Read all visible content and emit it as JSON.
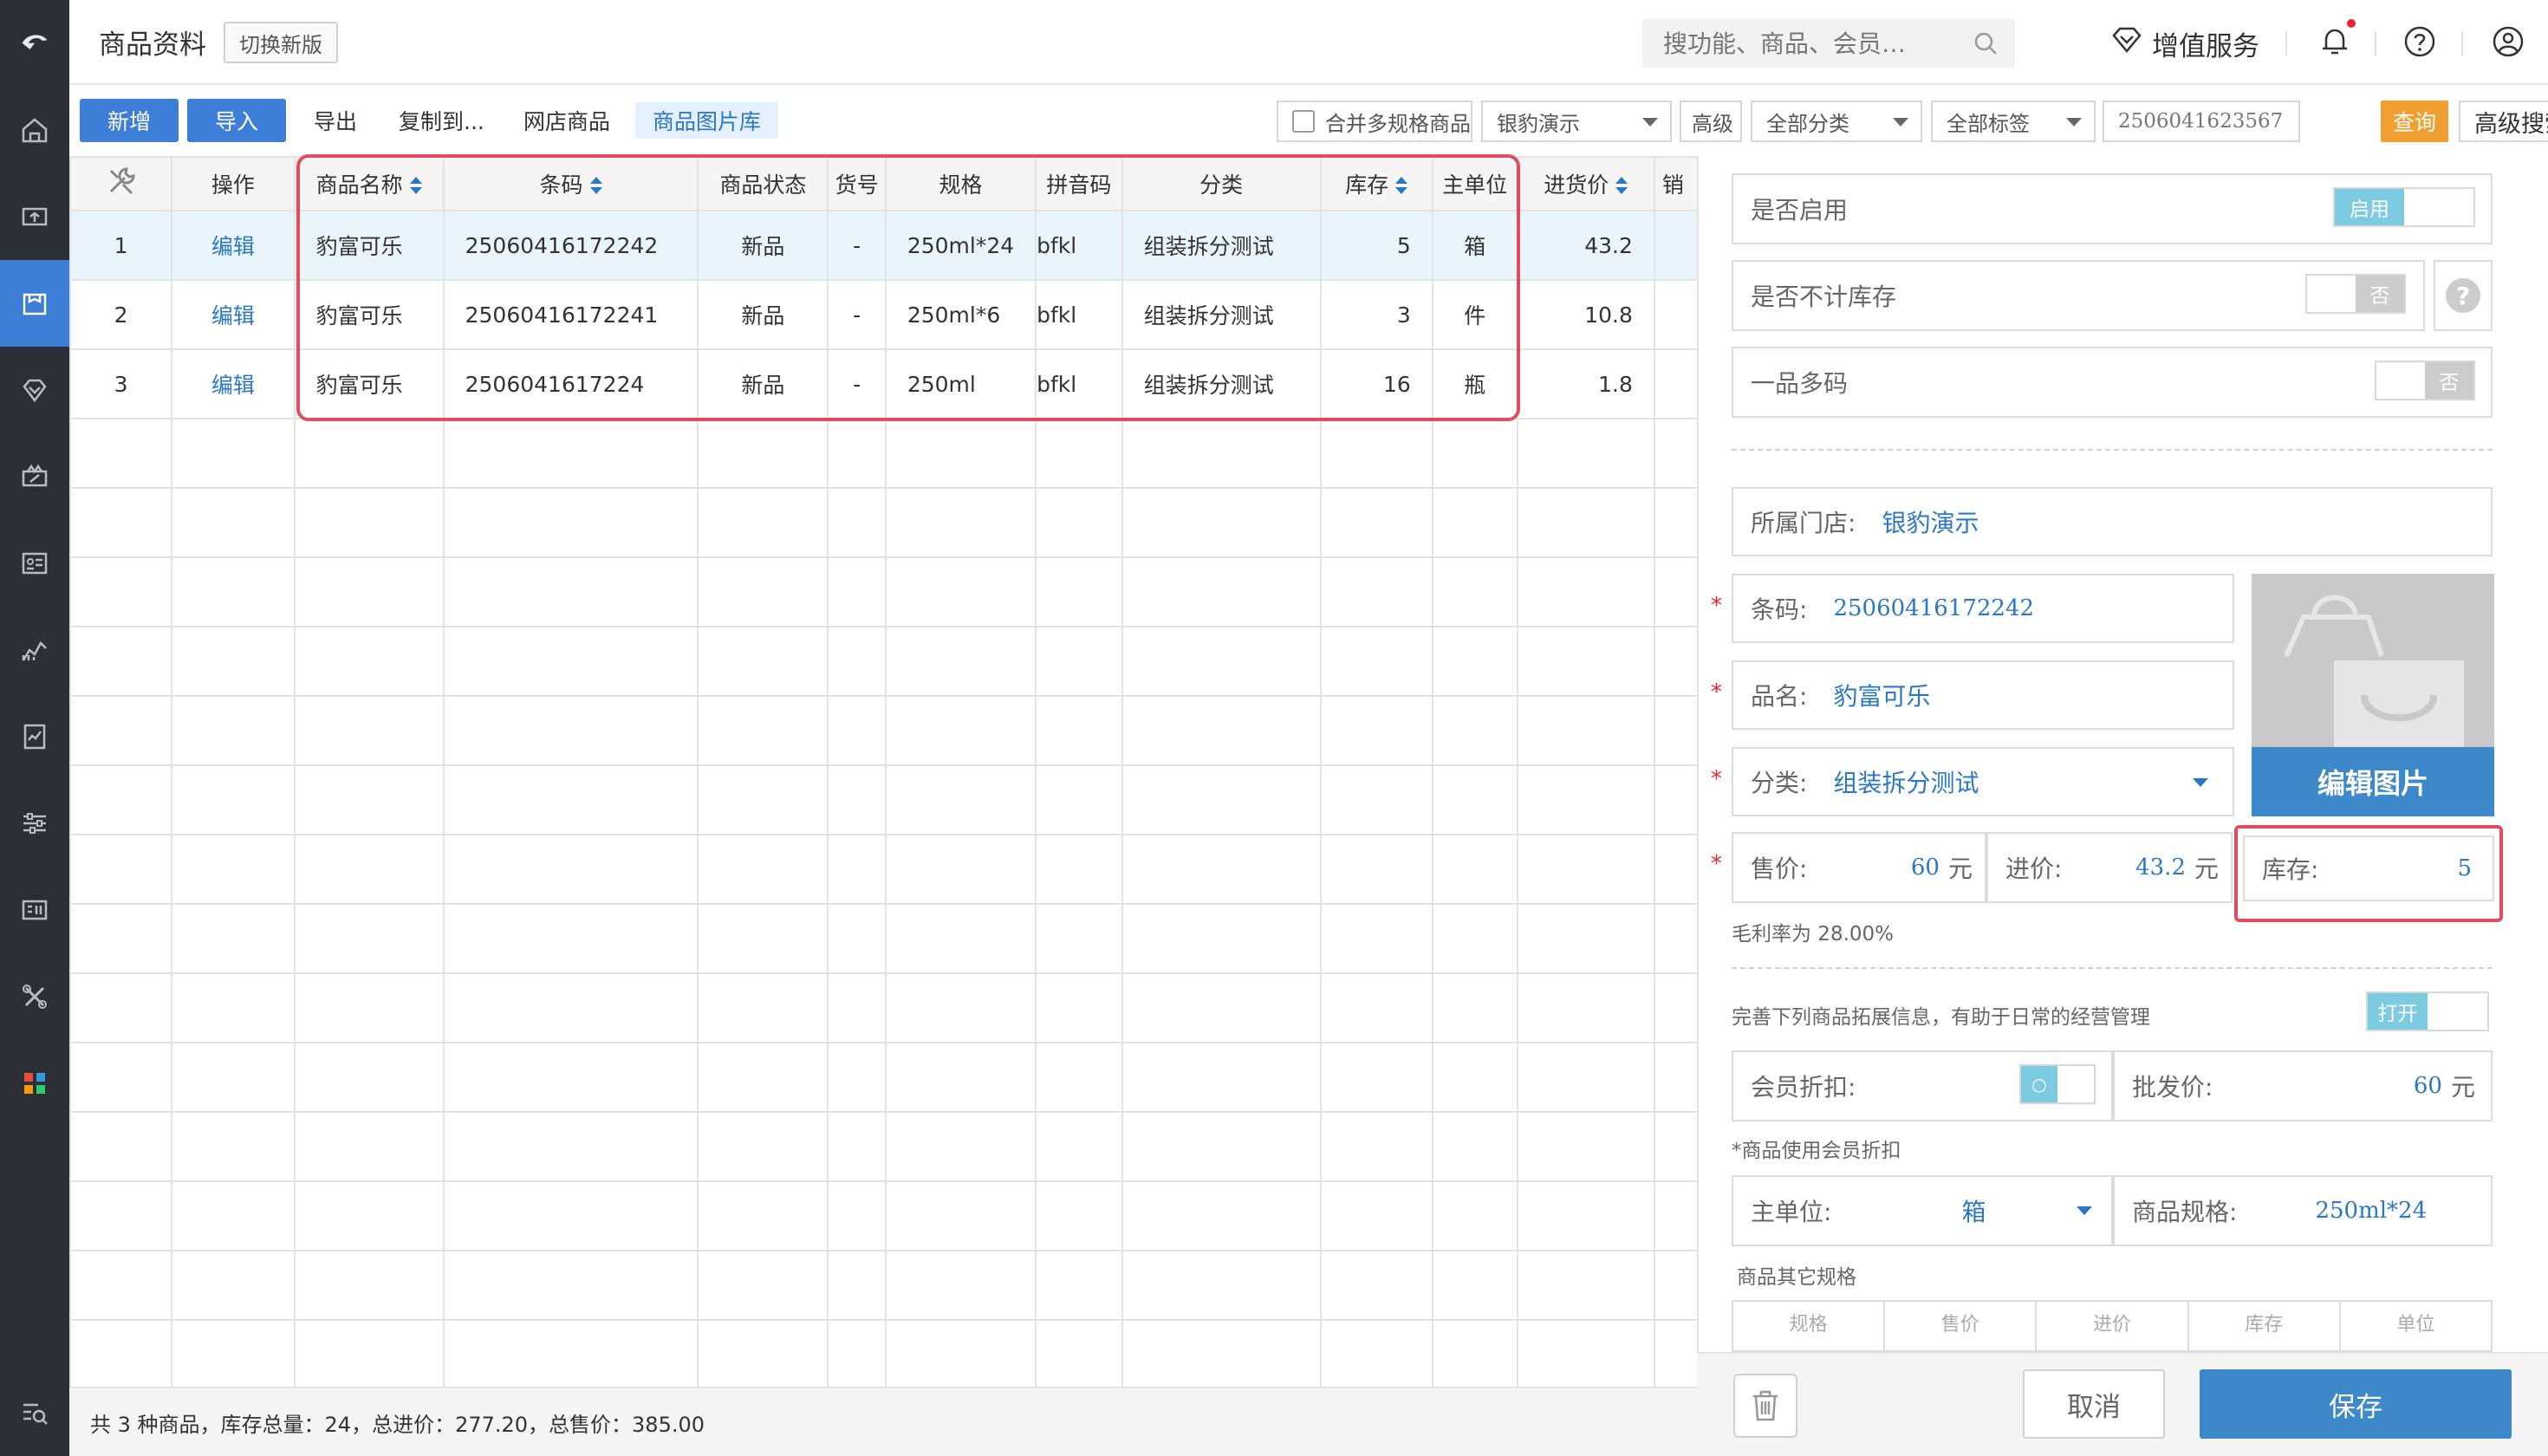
{
  "header": {
    "title": "商品资料",
    "switch_label": "切换新版",
    "search_placeholder": "搜功能、商品、会员…",
    "value_added": "增值服务"
  },
  "toolbar": {
    "add": "新增",
    "import": "导入",
    "export": "导出",
    "copy_to": "复制到...",
    "online_goods": "网店商品",
    "image_library": "商品图片库",
    "merge_multi_spec": "合并多规格商品",
    "store_select": "银豹演示",
    "advanced": "高级",
    "category_select": "全部分类",
    "tag_select": "全部标签",
    "search_value": "2506041623567",
    "query": "查询",
    "advanced_search": "高级搜索"
  },
  "table": {
    "columns": [
      "操作",
      "商品名称",
      "条码",
      "商品状态",
      "货号",
      "规格",
      "拼音码",
      "分类",
      "库存",
      "主单位",
      "进货价",
      "销"
    ],
    "rows": [
      {
        "idx": "1",
        "op": "编辑",
        "name": "豹富可乐",
        "barcode": "25060416172242",
        "status": "新品",
        "sku": "-",
        "spec": "250ml*24",
        "pinyin": "bfkl",
        "category": "组装拆分测试",
        "stock": "5",
        "unit": "箱",
        "cost": "43.2"
      },
      {
        "idx": "2",
        "op": "编辑",
        "name": "豹富可乐",
        "barcode": "25060416172241",
        "status": "新品",
        "sku": "-",
        "spec": "250ml*6",
        "pinyin": "bfkl",
        "category": "组装拆分测试",
        "stock": "3",
        "unit": "件",
        "cost": "10.8"
      },
      {
        "idx": "3",
        "op": "编辑",
        "name": "豹富可乐",
        "barcode": "2506041617224",
        "status": "新品",
        "sku": "-",
        "spec": "250ml",
        "pinyin": "bfkl",
        "category": "组装拆分测试",
        "stock": "16",
        "unit": "瓶",
        "cost": "1.8"
      }
    ],
    "summary": "共 3 种商品，库存总量：24，总进价：277.20，总售价：385.00"
  },
  "panel": {
    "enabled_label": "是否启用",
    "enabled_toggle": "启用",
    "no_stock_label": "是否不计库存",
    "no_stock_toggle": "否",
    "multi_code_label": "一品多码",
    "multi_code_toggle": "否",
    "store_label": "所属门店:",
    "store_value": "银豹演示",
    "barcode_label": "条码:",
    "barcode_value": "25060416172242",
    "name_label": "品名:",
    "name_value": "豹富可乐",
    "category_label": "分类:",
    "category_value": "组装拆分测试",
    "edit_image": "编辑图片",
    "price_label": "售价:",
    "price_value": "60",
    "cost_label": "进价:",
    "cost_value": "43.2",
    "yuan": "元",
    "stock_label": "库存:",
    "stock_value": "5",
    "margin_note": "毛利率为 28.00%",
    "extend_note": "完善下列商品拓展信息，有助于日常的经营管理",
    "extend_toggle": "打开",
    "member_discount_label": "会员折扣:",
    "member_discount_toggle": "○",
    "wholesale_label": "批发价:",
    "wholesale_value": "60",
    "member_note": "*商品使用会员折扣",
    "main_unit_label": "主单位:",
    "main_unit_value": "箱",
    "spec_label": "商品规格:",
    "spec_value": "250ml*24",
    "other_spec_label": "商品其它规格",
    "sub_columns": [
      "规格",
      "售价",
      "进价",
      "库存",
      "单位"
    ],
    "cancel": "取消",
    "save": "保存"
  },
  "colors": {
    "accent": "#3d7ed6",
    "rail": "#2b2f36",
    "highlight": "#e14d5d",
    "query": "#f0a030"
  }
}
